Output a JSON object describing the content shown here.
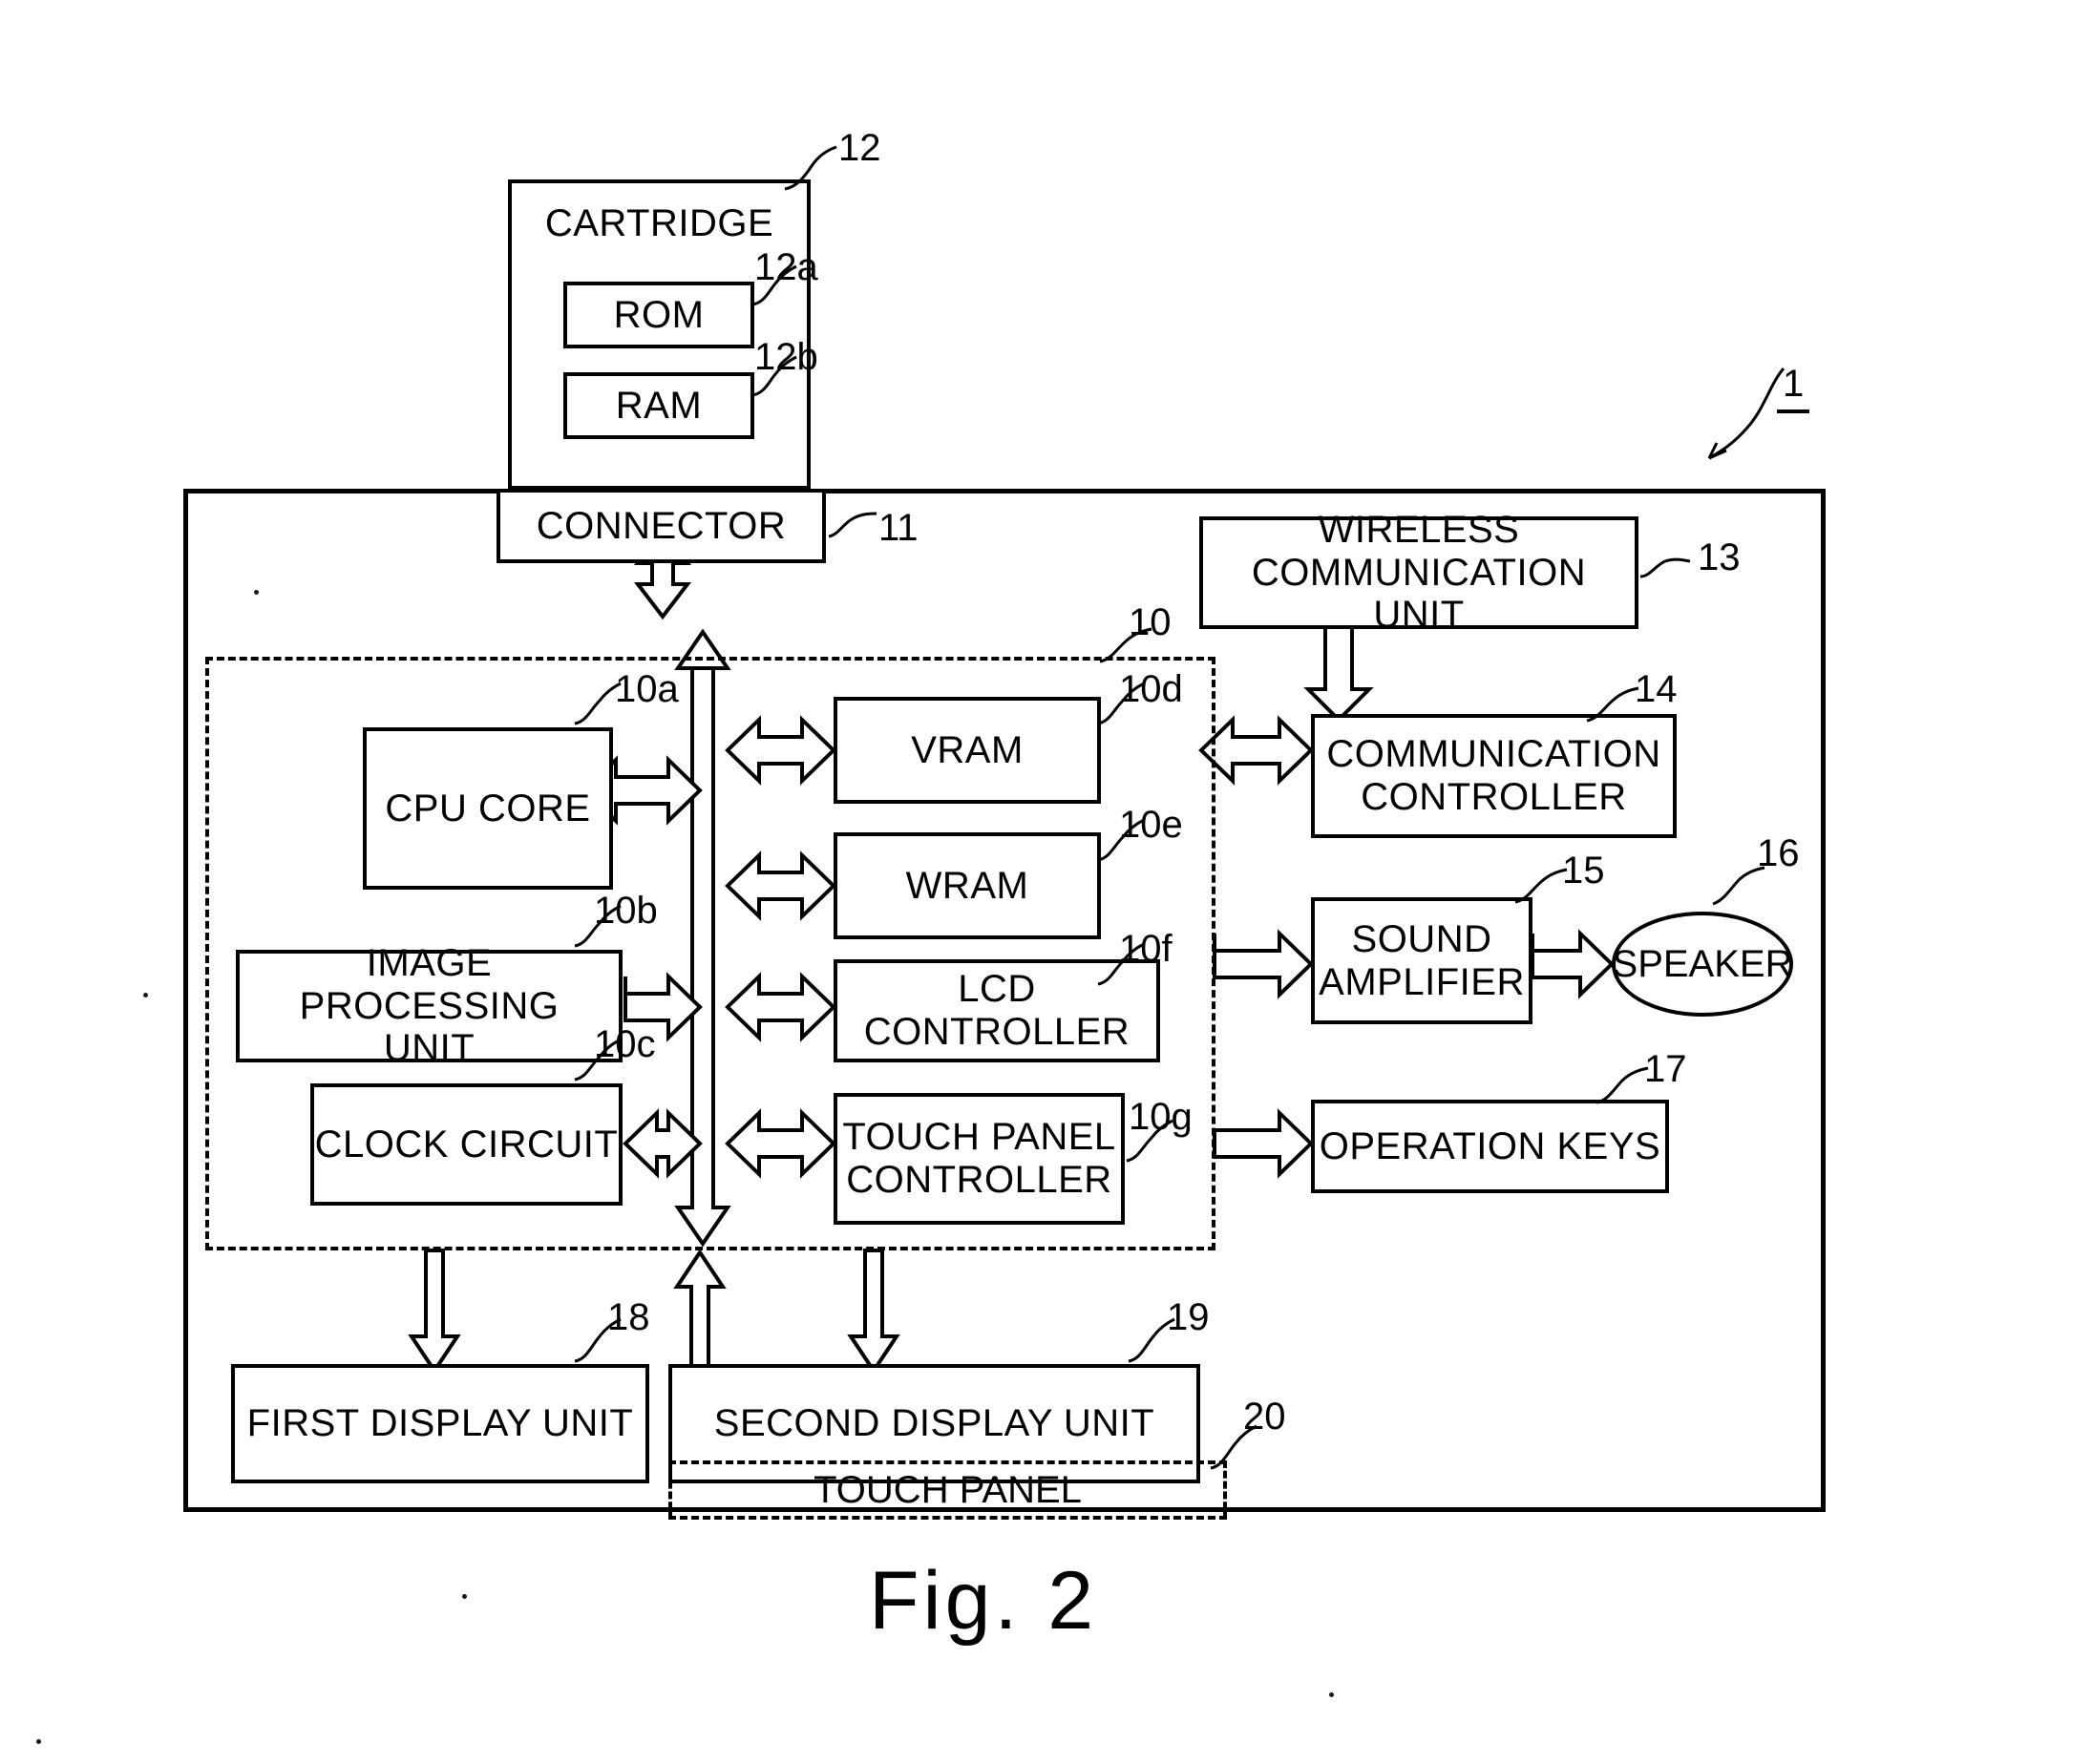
{
  "figure": {
    "caption": "Fig. 2",
    "device_ref": "1"
  },
  "blocks": {
    "cartridge": {
      "label": "CARTRIDGE",
      "ref": "12"
    },
    "rom": {
      "label": "ROM",
      "ref": "12a"
    },
    "ram": {
      "label": "RAM",
      "ref": "12b"
    },
    "connector": {
      "label": "CONNECTOR",
      "ref": "11"
    },
    "wireless_unit": {
      "label_line1": "WIRELESS",
      "label_line2": "COMMUNICATION UNIT",
      "ref": "13"
    },
    "comm_controller": {
      "label_line1": "COMMUNICATION",
      "label_line2": "CONTROLLER",
      "ref": "14"
    },
    "sound_amplifier": {
      "label_line1": "SOUND",
      "label_line2": "AMPLIFIER",
      "ref": "15"
    },
    "speaker": {
      "label": "SPEAKER",
      "ref": "16"
    },
    "operation_keys": {
      "label": "OPERATION KEYS",
      "ref": "17"
    },
    "electronic_circuit": {
      "ref": "10"
    },
    "cpu_core": {
      "label": "CPU CORE",
      "ref": "10a"
    },
    "image_processing": {
      "label_line1": "IMAGE PROCESSING",
      "label_line2": "UNIT",
      "ref": "10b"
    },
    "clock_circuit": {
      "label": "CLOCK CIRCUIT",
      "ref": "10c"
    },
    "vram": {
      "label": "VRAM",
      "ref": "10d"
    },
    "wram": {
      "label": "WRAM",
      "ref": "10e"
    },
    "lcd_controller": {
      "label": "LCD CONTROLLER",
      "ref": "10f"
    },
    "touch_panel_ctrl": {
      "label_line1": "TOUCH PANEL",
      "label_line2": "CONTROLLER",
      "ref": "10g"
    },
    "first_display": {
      "label": "FIRST DISPLAY UNIT",
      "ref": "18"
    },
    "second_display": {
      "label": "SECOND DISPLAY UNIT",
      "ref": "19"
    },
    "touch_panel": {
      "label": "TOUCH PANEL",
      "ref": "20"
    }
  },
  "colors": {
    "stroke": "#000000",
    "background": "#ffffff"
  }
}
